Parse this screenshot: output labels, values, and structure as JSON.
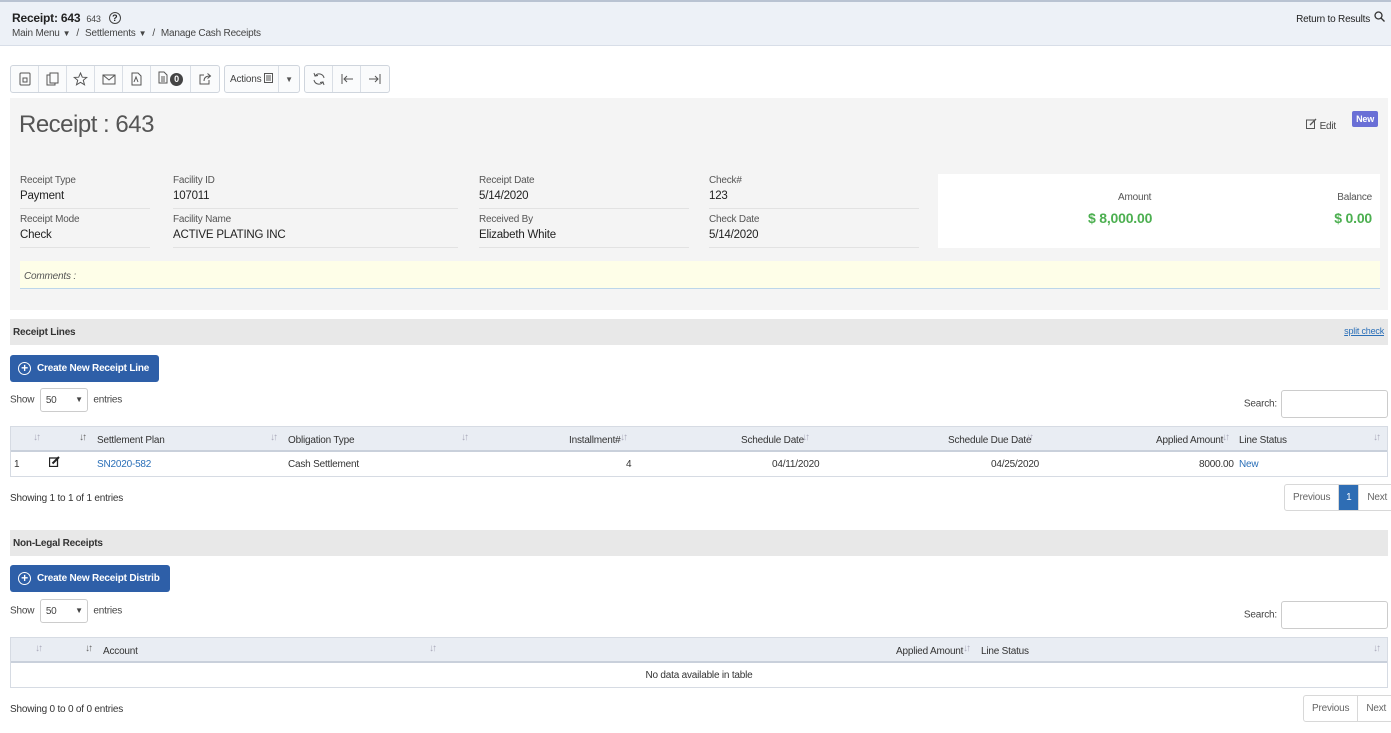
{
  "header": {
    "title": "Receipt: 643",
    "subtitle": "643",
    "help": "?",
    "breadcrumbs": [
      "Main Menu",
      "Settlements",
      "Manage Cash Receipts"
    ],
    "return_label": "Return to Results"
  },
  "toolbar": {
    "badge_count": "0",
    "actions_label": "Actions"
  },
  "receipt": {
    "title": "Receipt : 643",
    "edit_label": "Edit",
    "status_badge": "New",
    "fields": {
      "receipt_type": {
        "label": "Receipt Type",
        "value": "Payment"
      },
      "receipt_mode": {
        "label": "Receipt Mode",
        "value": "Check"
      },
      "facility_id": {
        "label": "Facility ID",
        "value": "107011"
      },
      "facility_name": {
        "label": "Facility Name",
        "value": "ACTIVE PLATING INC"
      },
      "receipt_date": {
        "label": "Receipt Date",
        "value": "5/14/2020"
      },
      "received_by": {
        "label": "Received By",
        "value": "Elizabeth White"
      },
      "check_no": {
        "label": "Check#",
        "value": "123"
      },
      "check_date": {
        "label": "Check Date",
        "value": "5/14/2020"
      }
    },
    "amount": {
      "label": "Amount",
      "value": "$ 8,000.00"
    },
    "balance": {
      "label": "Balance",
      "value": "$ 0.00"
    },
    "comments_label": "Comments :"
  },
  "receipt_lines": {
    "section_title": "Receipt Lines",
    "split_link": "split check",
    "create_button": "Create New Receipt Line",
    "show_label": "Show",
    "entries_value": "50",
    "entries_label": "entries",
    "search_label": "Search:",
    "columns": [
      "Settlement Plan",
      "Obligation Type",
      "Installment#",
      "Schedule Date",
      "Schedule Due Date",
      "Applied Amount",
      "Line Status"
    ],
    "rows": [
      {
        "num": "1",
        "plan": "SN2020-582",
        "obligation": "Cash Settlement",
        "installment": "4",
        "schedule_date": "04/11/2020",
        "due_date": "04/25/2020",
        "applied": "8000.00",
        "status": "New"
      }
    ],
    "info": "Showing 1 to 1 of 1 entries",
    "pager": {
      "prev": "Previous",
      "page": "1",
      "next": "Next"
    }
  },
  "non_legal": {
    "section_title": "Non-Legal Receipts",
    "create_button": "Create New Receipt Distrib",
    "show_label": "Show",
    "entries_value": "50",
    "entries_label": "entries",
    "search_label": "Search:",
    "columns": [
      "Account",
      "Applied Amount",
      "Line Status"
    ],
    "empty": "No data available in table",
    "info": "Showing 0 to 0 of 0 entries",
    "pager": {
      "prev": "Previous",
      "next": "Next"
    }
  },
  "colors": {
    "accent": "#2e5fa8",
    "money": "#4caf50",
    "badge": "#6a6fd6"
  }
}
